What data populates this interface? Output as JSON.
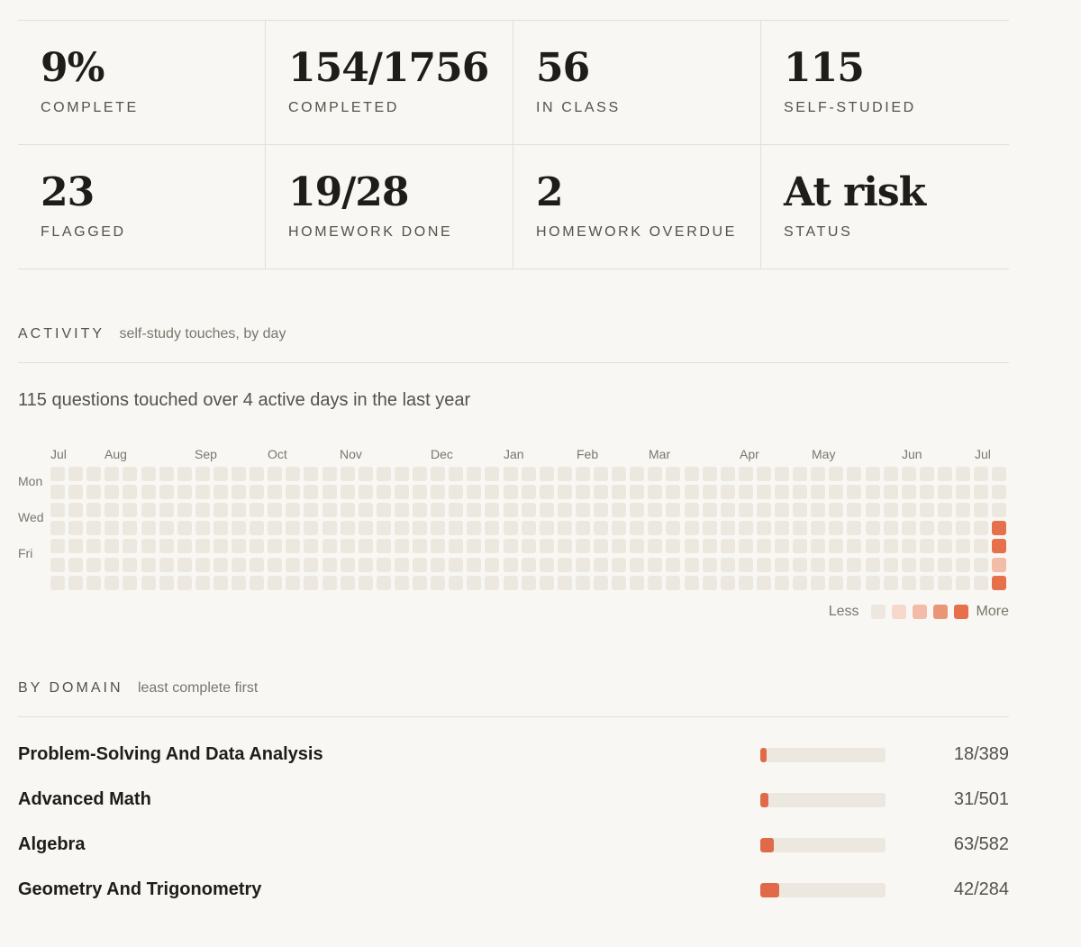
{
  "stats": [
    {
      "value": "9%",
      "label": "COMPLETE"
    },
    {
      "value": "154/1756",
      "label": "COMPLETED"
    },
    {
      "value": "56",
      "label": "IN CLASS"
    },
    {
      "value": "115",
      "label": "SELF-STUDIED"
    },
    {
      "value": "23",
      "label": "FLAGGED"
    },
    {
      "value": "19/28",
      "label": "HOMEWORK DONE"
    },
    {
      "value": "2",
      "label": "HOMEWORK OVERDUE"
    },
    {
      "value": "At risk",
      "label": "STATUS"
    }
  ],
  "activity": {
    "title": "ACTIVITY",
    "subtitle": "self-study touches, by day",
    "summary": "115 questions touched over 4 active days in the last year",
    "months": [
      "Jul",
      "Aug",
      "Sep",
      "Oct",
      "Nov",
      "Dec",
      "Jan",
      "Feb",
      "Mar",
      "Apr",
      "May",
      "Jun",
      "Jul"
    ],
    "day_labels": [
      "Mon",
      "Wed",
      "Fri"
    ],
    "weeks": 53,
    "active_cells": [
      {
        "week": 52,
        "day": 3,
        "level": 4
      },
      {
        "week": 52,
        "day": 4,
        "level": 4
      },
      {
        "week": 52,
        "day": 5,
        "level": 2
      },
      {
        "week": 52,
        "day": 6,
        "level": 4
      }
    ],
    "legend": {
      "less": "Less",
      "more": "More",
      "levels": [
        "#ece8e0",
        "#f7d9cc",
        "#f2bca8",
        "#eb9577",
        "#e7704c"
      ]
    }
  },
  "by_domain": {
    "title": "BY DOMAIN",
    "subtitle": "least complete first",
    "rows": [
      {
        "name": "Problem-Solving And Data Analysis",
        "done": 18,
        "total": 389,
        "label": "18/389"
      },
      {
        "name": "Advanced Math",
        "done": 31,
        "total": 501,
        "label": "31/501"
      },
      {
        "name": "Algebra",
        "done": 63,
        "total": 582,
        "label": "63/582"
      },
      {
        "name": "Geometry And Trigonometry",
        "done": 42,
        "total": 284,
        "label": "42/284"
      }
    ]
  },
  "colors": {
    "accent": "#e06a48",
    "empty_cell": "#ece8e0",
    "background": "#f9f7f3"
  }
}
